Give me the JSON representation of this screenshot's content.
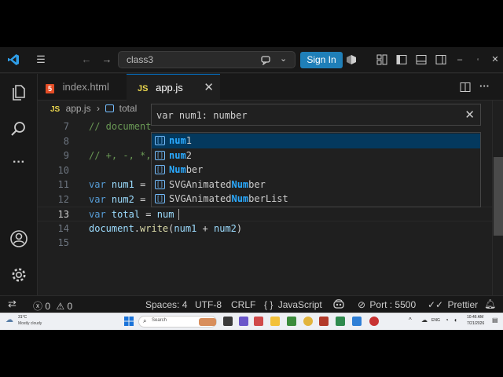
{
  "titlebar": {
    "search_text": "class3",
    "sign_in": "Sign In"
  },
  "tabs": [
    {
      "icon": "5",
      "label": "index.html"
    },
    {
      "icon": "JS",
      "label": "app.js",
      "close": "✕"
    }
  ],
  "breadcrumb": {
    "file_icon": "JS",
    "file": "app.js",
    "sep": "›",
    "symbol": "total"
  },
  "editor": {
    "current_line": 13,
    "lines": [
      {
        "n": "7",
        "text": "// document"
      },
      {
        "n": "8",
        "text": ""
      },
      {
        "n": "9",
        "text": "// +, -, *,"
      },
      {
        "n": "10",
        "text": ""
      },
      {
        "n": "11",
        "text": "var num1 ="
      },
      {
        "n": "12",
        "text": "var num2 ="
      },
      {
        "n": "13",
        "text": "var total = num"
      },
      {
        "n": "14",
        "text": "document.write(num1 + num2)"
      },
      {
        "n": "15",
        "text": ""
      }
    ]
  },
  "hover": {
    "text": "var num1: number",
    "close": "✕"
  },
  "suggestions": [
    {
      "match": "num",
      "rest": "1",
      "selected": true
    },
    {
      "match": "num",
      "rest": "2",
      "selected": false
    },
    {
      "match": "Num",
      "rest": "ber",
      "selected": false
    },
    {
      "prefix": "SVGAnimated",
      "match": "Num",
      "rest": "ber",
      "selected": false
    },
    {
      "prefix": "SVGAnimated",
      "match": "Num",
      "rest": "berList",
      "selected": false
    }
  ],
  "statusbar": {
    "errors": "0",
    "warnings": "0",
    "spaces": "Spaces: 4",
    "encoding": "UTF-8",
    "eol": "CRLF",
    "language_icon": "{ }",
    "language": "JavaScript",
    "port": "Port : 5500",
    "prettier": "Prettier"
  },
  "taskbar": {
    "weather_temp": "31°C",
    "weather_desc": "Mostly cloudy",
    "search": "Search",
    "lang": "ENG",
    "time": "10:46 AM",
    "date": "7/21/2026"
  },
  "colors": {
    "accent": "#0078d4",
    "signin": "#1f7fb8",
    "keyword": "#569cd6",
    "variable": "#9cdcfe",
    "function": "#dcdcaa",
    "comment": "#6a9955"
  }
}
